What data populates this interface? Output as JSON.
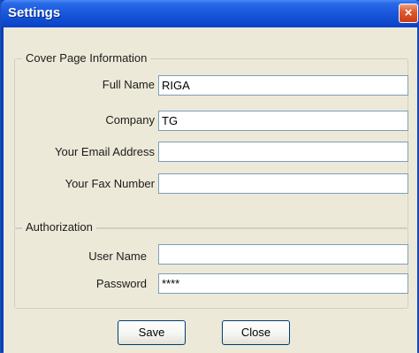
{
  "window": {
    "title": "Settings",
    "close_glyph": "×"
  },
  "cover_page": {
    "legend": "Cover Page Information",
    "full_name_label": "Full Name",
    "full_name_value": "RIGA",
    "company_label": "Company",
    "company_value": "TG",
    "email_label": "Your Email Address",
    "email_value": "",
    "fax_label": "Your Fax Number",
    "fax_value": ""
  },
  "authorization": {
    "legend": "Authorization",
    "username_label": "User Name",
    "username_value": "",
    "password_label": "Password",
    "password_value": "****"
  },
  "buttons": {
    "save": "Save",
    "close": "Close"
  },
  "colors": {
    "titlebar": "#0a41c4",
    "close_button": "#e05a30",
    "dialog_face": "#ece9d8",
    "field_border": "#7f9db9",
    "button_border": "#003c74"
  }
}
